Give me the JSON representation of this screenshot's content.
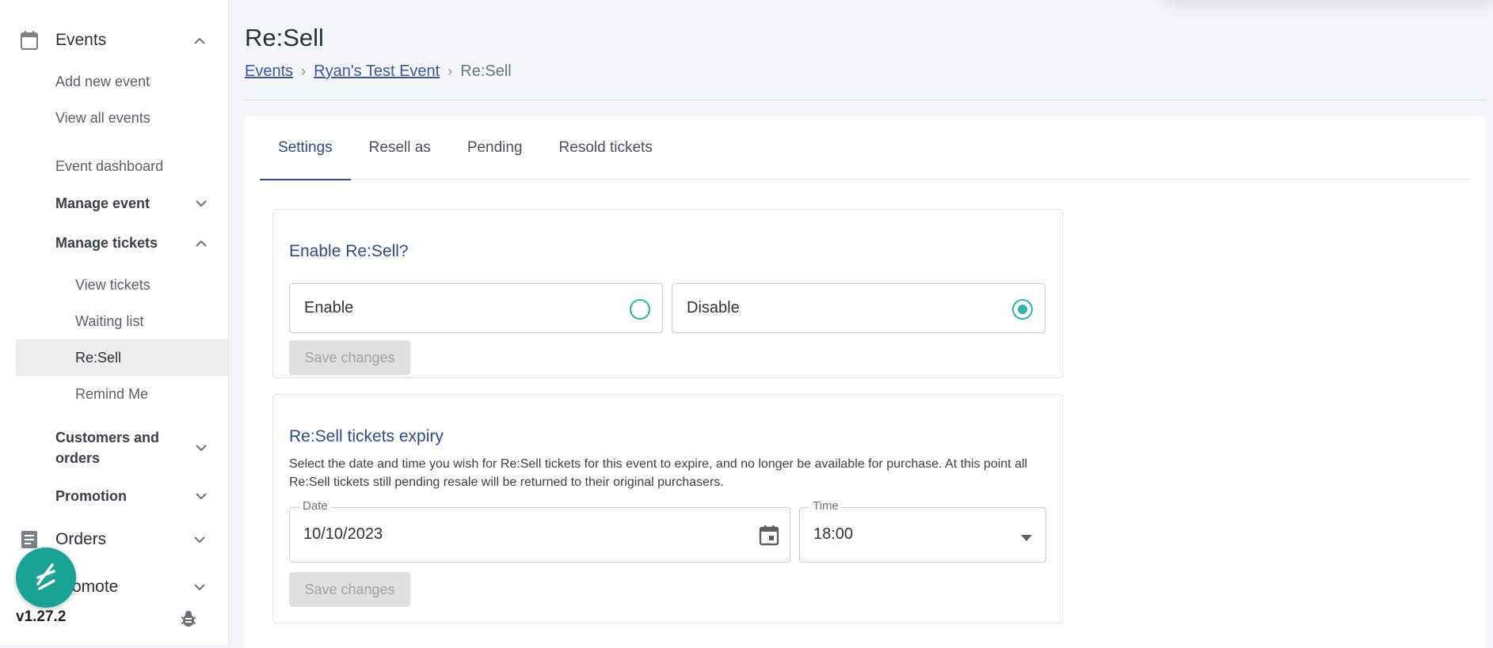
{
  "sidebar": {
    "events": {
      "label": "Events",
      "icon": "calendar-icon"
    },
    "add_new_event": "Add new event",
    "view_all_events": "View all events",
    "event_dashboard": "Event dashboard",
    "manage_event": "Manage event",
    "manage_tickets": "Manage tickets",
    "view_tickets": "View tickets",
    "waiting_list": "Waiting list",
    "resell": "Re:Sell",
    "remind_me": "Remind Me",
    "customers_orders": "Customers and orders",
    "promotion": "Promotion",
    "orders": {
      "label": "Orders",
      "icon": "document-icon"
    },
    "promote": "Promote",
    "version": "v1.27.2"
  },
  "header": {
    "title": "Re:Sell",
    "breadcrumb": {
      "events": "Events",
      "event_name": "Ryan's Test Event",
      "current": "Re:Sell"
    }
  },
  "tabs": [
    "Settings",
    "Resell as",
    "Pending",
    "Resold tickets"
  ],
  "enable_panel": {
    "title": "Enable Re:Sell?",
    "options": [
      {
        "label": "Enable",
        "checked": false
      },
      {
        "label": "Disable",
        "checked": true
      }
    ],
    "save_label": "Save changes"
  },
  "expiry_panel": {
    "title": "Re:Sell tickets expiry",
    "description": "Select the date and time you wish for Re:Sell tickets for this event to expire, and no longer be available for purchase. At this point all Re:Sell tickets still pending resale will be returned to their original purchasers.",
    "date_label": "Date",
    "date_value": "10/10/2023",
    "time_label": "Time",
    "time_value": "18:00",
    "save_label": "Save changes"
  },
  "colors": {
    "accent": "#2d4a8a",
    "teal": "#18a393",
    "radio": "#2fb5a9"
  }
}
